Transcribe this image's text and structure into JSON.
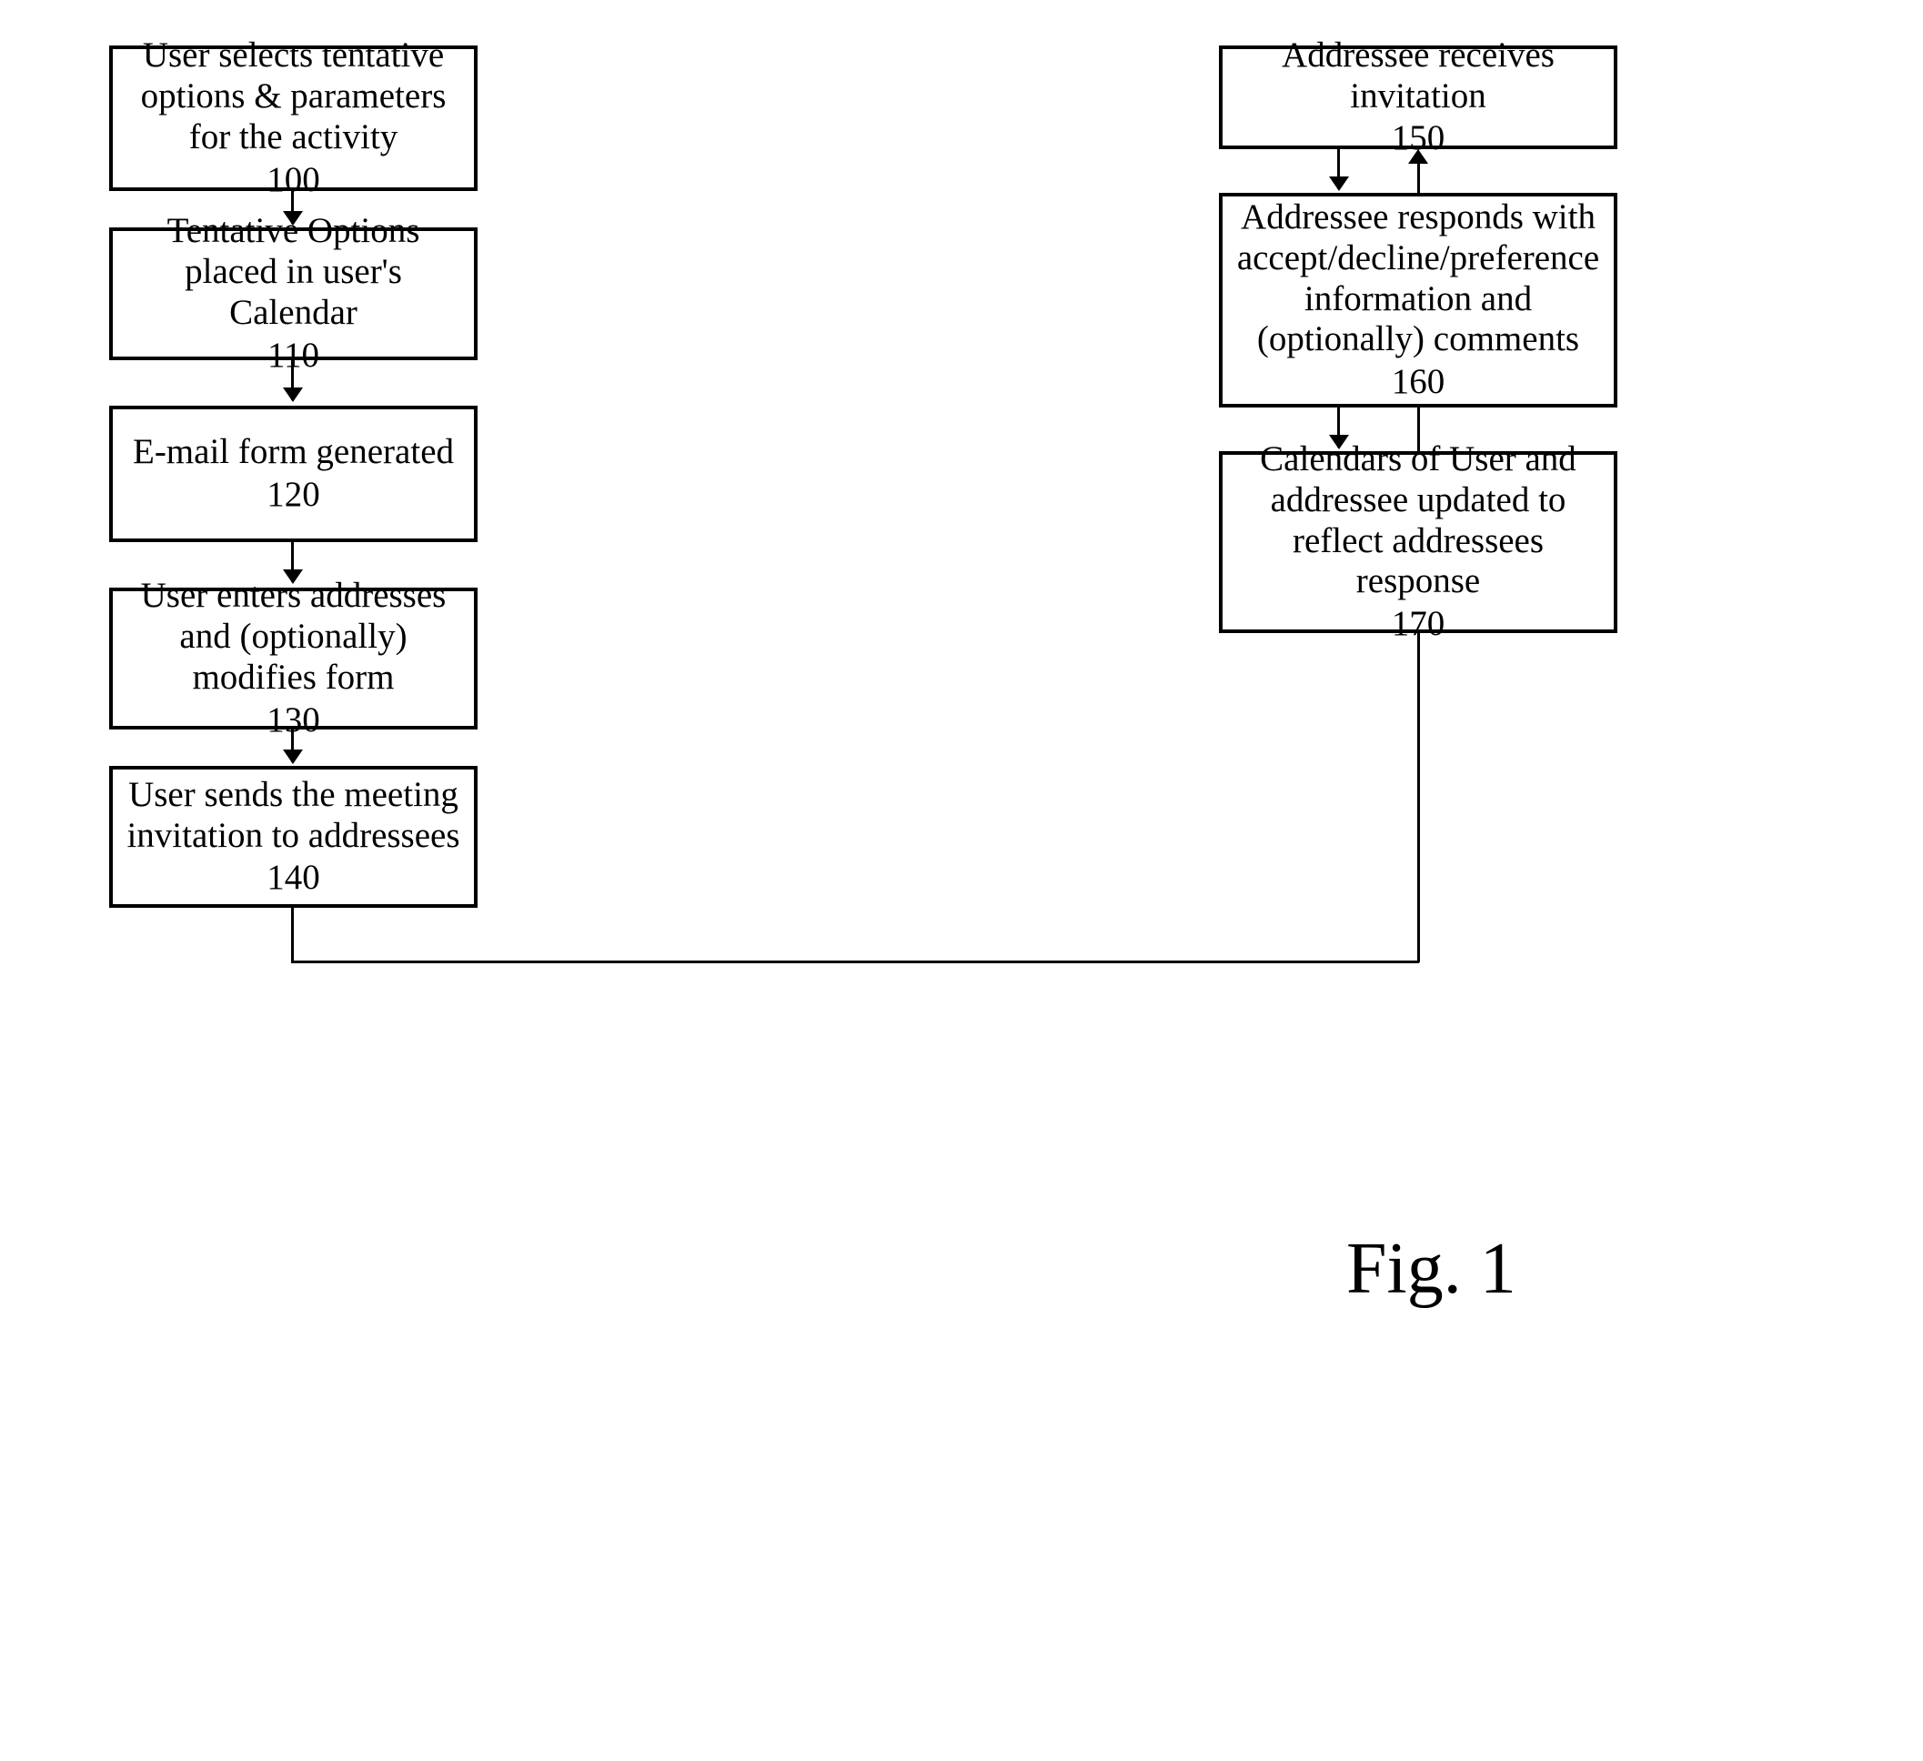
{
  "chart_data": {
    "type": "flowchart",
    "title": "Fig. 1",
    "nodes": [
      {
        "id": "100",
        "text": "User selects tentative options & parameters for the activity",
        "ref": "100",
        "column": 1,
        "order": 1
      },
      {
        "id": "110",
        "text": "Tentative Options placed in user's Calendar",
        "ref": "110",
        "column": 1,
        "order": 2
      },
      {
        "id": "120",
        "text": "E-mail form generated",
        "ref": "120",
        "column": 1,
        "order": 3
      },
      {
        "id": "130",
        "text": "User enters addresses and (optionally) modifies form",
        "ref": "130",
        "column": 1,
        "order": 4
      },
      {
        "id": "140",
        "text": "User sends the meeting invitation to addressees",
        "ref": "140",
        "column": 1,
        "order": 5
      },
      {
        "id": "150",
        "text": "Addressee receives invitation",
        "ref": "150",
        "column": 2,
        "order": 1
      },
      {
        "id": "160",
        "text": "Addressee responds with accept/decline/preference information and (optionally) comments",
        "ref": "160",
        "column": 2,
        "order": 2
      },
      {
        "id": "170",
        "text": "Calendars of User and addressee updated to reflect addressees response",
        "ref": "170",
        "column": 2,
        "order": 3
      }
    ],
    "edges": [
      {
        "from": "100",
        "to": "110"
      },
      {
        "from": "110",
        "to": "120"
      },
      {
        "from": "120",
        "to": "130"
      },
      {
        "from": "130",
        "to": "140"
      },
      {
        "from": "140",
        "to": "150"
      },
      {
        "from": "150",
        "to": "160"
      },
      {
        "from": "160",
        "to": "170"
      }
    ]
  },
  "figure_label": "Fig. 1"
}
